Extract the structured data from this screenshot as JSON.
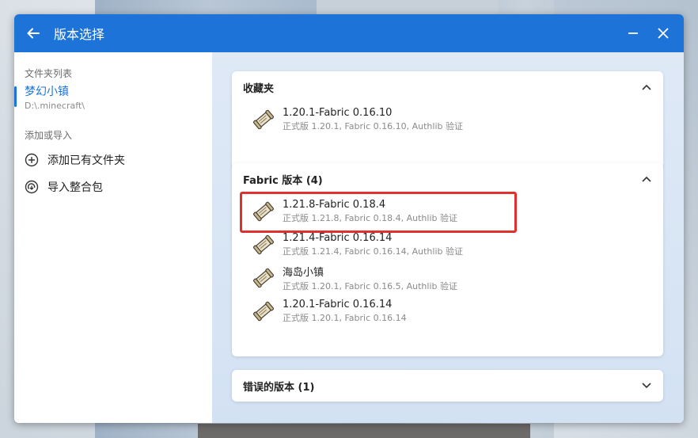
{
  "window": {
    "title": "版本选择",
    "back_icon": "arrow-left-icon",
    "minimize_icon": "minimize-icon",
    "close_icon": "close-icon",
    "accent_color": "#1e73d8"
  },
  "sidebar": {
    "folders_label": "文件夹列表",
    "folder": {
      "name": "梦幻小镇",
      "path": "D:\\.minecraft\\"
    },
    "add_label": "添加或导入",
    "actions": [
      {
        "label": "添加已有文件夹",
        "icon": "plus-circle-icon"
      },
      {
        "label": "导入整合包",
        "icon": "import-icon"
      }
    ]
  },
  "favorites": {
    "title": "收藏夹",
    "expanded": true,
    "items": [
      {
        "name": "1.20.1-Fabric 0.16.10",
        "desc": "正式版 1.20.1, Fabric 0.16.10, Authlib 验证"
      }
    ]
  },
  "fabric": {
    "title": "Fabric 版本 (4)",
    "expanded": true,
    "highlight_color": "#e03131",
    "items": [
      {
        "name": "1.21.8-Fabric 0.18.4",
        "desc": "正式版 1.21.8, Fabric 0.18.4, Authlib 验证",
        "highlighted": true
      },
      {
        "name": "1.21.4-Fabric 0.16.14",
        "desc": "正式版 1.21.4, Fabric 0.16.14, Authlib 验证"
      },
      {
        "name": "海岛小镇",
        "desc": "正式版 1.20.1, Fabric 0.16.5, Authlib 验证"
      },
      {
        "name": "1.20.1-Fabric 0.16.14",
        "desc": "正式版 1.20.1, Fabric 0.16.14"
      }
    ]
  },
  "errors": {
    "title": "错误的版本 (1)",
    "expanded": false
  }
}
